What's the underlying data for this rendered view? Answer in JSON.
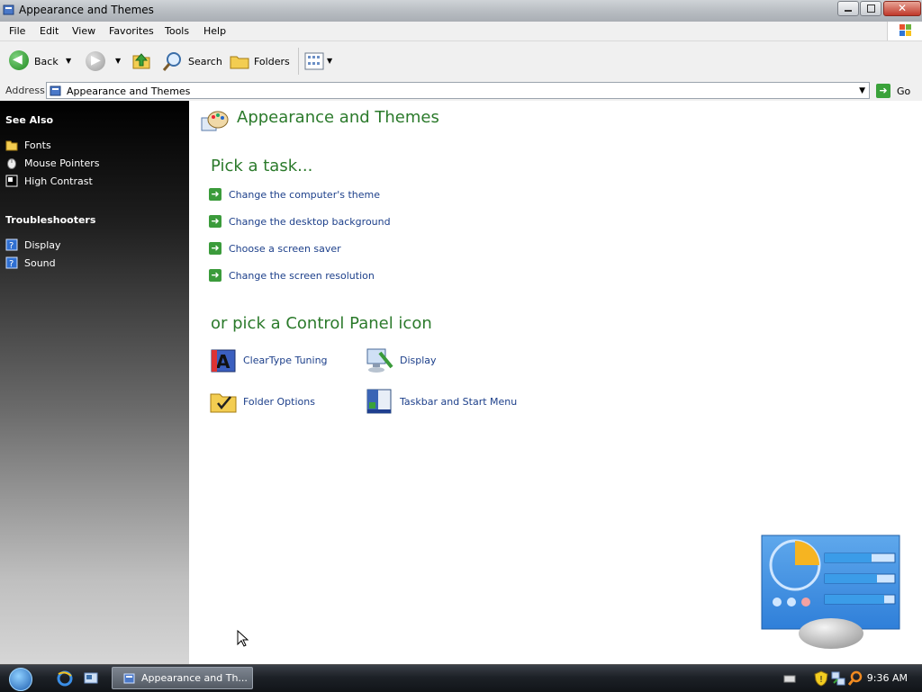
{
  "window": {
    "title": "Appearance and Themes"
  },
  "menu": {
    "items": [
      "File",
      "Edit",
      "View",
      "Favorites",
      "Tools",
      "Help"
    ]
  },
  "toolbar": {
    "back_label": "Back",
    "search_label": "Search",
    "folders_label": "Folders"
  },
  "address": {
    "label": "Address",
    "value": "Appearance and Themes",
    "go_label": "Go"
  },
  "sidebar": {
    "see_also_heading": "See Also",
    "see_also": [
      {
        "label": "Fonts",
        "icon": "folder-icon"
      },
      {
        "label": "Mouse Pointers",
        "icon": "mouse-icon"
      },
      {
        "label": "High Contrast",
        "icon": "contrast-icon"
      }
    ],
    "troubleshooters_heading": "Troubleshooters",
    "troubleshooters": [
      {
        "label": "Display",
        "icon": "help-icon"
      },
      {
        "label": "Sound",
        "icon": "help-icon"
      }
    ]
  },
  "main": {
    "page_title": "Appearance and Themes",
    "pick_task_heading": "Pick a task...",
    "tasks": [
      "Change the computer's theme",
      "Change the desktop background",
      "Choose a screen saver",
      "Change the screen resolution"
    ],
    "pick_icon_heading": "or pick a Control Panel icon",
    "icons": [
      {
        "label": "ClearType Tuning",
        "icon": "cleartype-icon"
      },
      {
        "label": "Display",
        "icon": "display-icon"
      },
      {
        "label": "Folder Options",
        "icon": "folder-options-icon"
      },
      {
        "label": "Taskbar and Start Menu",
        "icon": "taskbar-icon"
      }
    ]
  },
  "taskbar": {
    "task_label": "Appearance and Th...",
    "clock": "9:36 AM"
  },
  "colors": {
    "heading_green": "#2b7a2b",
    "link_blue": "#1c3f8a"
  }
}
